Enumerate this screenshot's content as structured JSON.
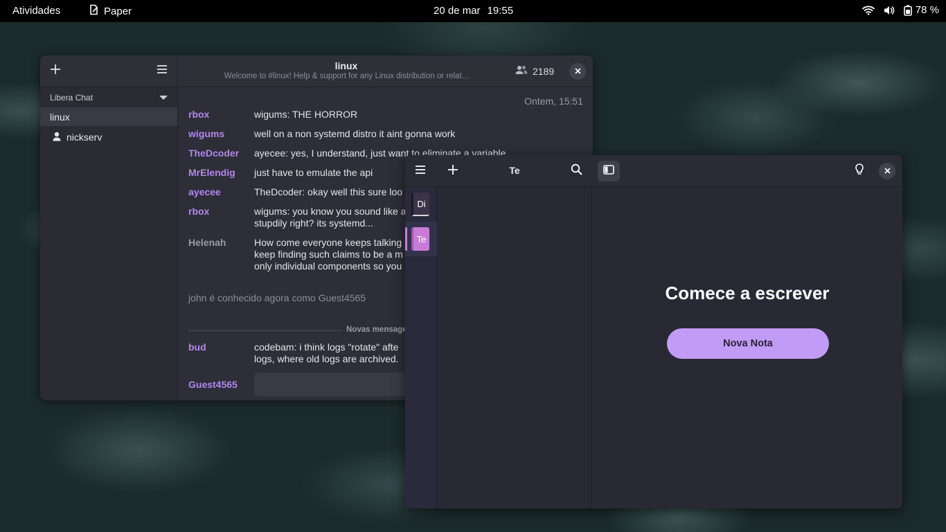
{
  "topbar": {
    "activities": "Atividades",
    "app_name": "Paper",
    "date": "20 de mar",
    "time": "19:55",
    "battery": "78 %"
  },
  "irc": {
    "network": "Libera Chat",
    "channel_item": "linux",
    "query_item": "nickserv",
    "title": "linux",
    "topic": "Welcome to #linux! Help & support for any Linux distribution or relat…",
    "user_count": "2189",
    "date_marker": "Ontem, 15:51",
    "messages": [
      {
        "nick": "rbox",
        "text": "wigums: THE HORROR"
      },
      {
        "nick": "wigums",
        "text": "well on a non systemd distro it aint gonna work"
      },
      {
        "nick": "TheDcoder",
        "text": "ayecee: yes, I understand, just want to eliminate a variable"
      },
      {
        "nick": "MrElendig",
        "text": "just have to emulate the api"
      },
      {
        "nick": "ayecee",
        "text": "TheDcoder: okay well this sure loo"
      },
      {
        "nick": "rbox",
        "text": "wigums: you know you sound like a stupdily right? its systemd..."
      },
      {
        "nick": "Helenah",
        "text": "How come everyone keeps talking keep finding such claims to be a m only individual components so you"
      }
    ],
    "system_message": "john é conhecido agora como Guest4565",
    "divider_label": "Novas mensagen",
    "after_divider": [
      {
        "nick": "bud",
        "text": "codebam: i think logs \"rotate\" afte logs, where old logs are archived."
      }
    ],
    "own_nick": "Guest4565"
  },
  "notes": {
    "title": "Te",
    "notebooks": [
      {
        "label": "Di",
        "color": "#3d3348"
      },
      {
        "label": "Te",
        "color": "#c87bd6"
      }
    ],
    "empty_title": "Comece a escrever",
    "new_note_label": "Nova Nota",
    "accent": "#c19bf5"
  }
}
